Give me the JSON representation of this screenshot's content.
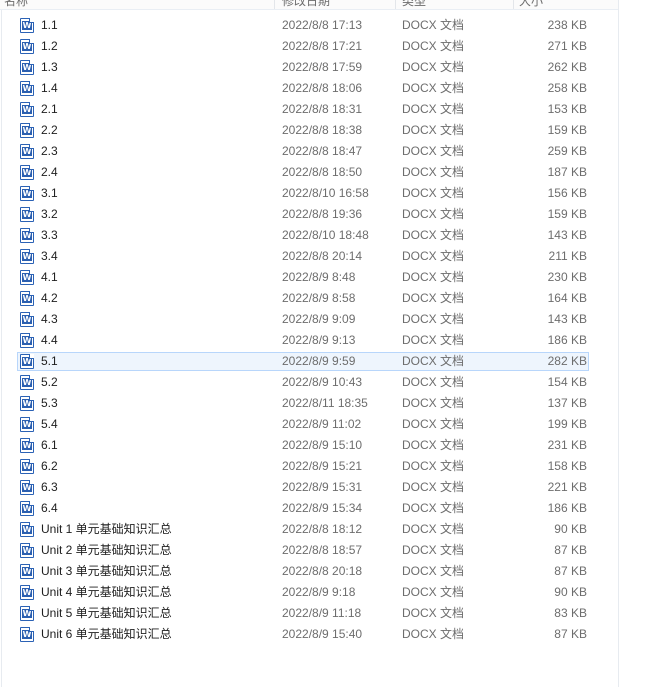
{
  "header": {
    "name": "名称",
    "date": "修改日期",
    "type": "类型",
    "size": "大小"
  },
  "icon_label": "W",
  "files": [
    {
      "name": "1.1",
      "date": "2022/8/8 17:13",
      "type": "DOCX 文档",
      "size": "238 KB"
    },
    {
      "name": "1.2",
      "date": "2022/8/8 17:21",
      "type": "DOCX 文档",
      "size": "271 KB"
    },
    {
      "name": "1.3",
      "date": "2022/8/8 17:59",
      "type": "DOCX 文档",
      "size": "262 KB"
    },
    {
      "name": "1.4",
      "date": "2022/8/8 18:06",
      "type": "DOCX 文档",
      "size": "258 KB"
    },
    {
      "name": "2.1",
      "date": "2022/8/8 18:31",
      "type": "DOCX 文档",
      "size": "153 KB"
    },
    {
      "name": "2.2",
      "date": "2022/8/8 18:38",
      "type": "DOCX 文档",
      "size": "159 KB"
    },
    {
      "name": "2.3",
      "date": "2022/8/8 18:47",
      "type": "DOCX 文档",
      "size": "259 KB"
    },
    {
      "name": "2.4",
      "date": "2022/8/8 18:50",
      "type": "DOCX 文档",
      "size": "187 KB"
    },
    {
      "name": "3.1",
      "date": "2022/8/10 16:58",
      "type": "DOCX 文档",
      "size": "156 KB"
    },
    {
      "name": "3.2",
      "date": "2022/8/8 19:36",
      "type": "DOCX 文档",
      "size": "159 KB"
    },
    {
      "name": "3.3",
      "date": "2022/8/10 18:48",
      "type": "DOCX 文档",
      "size": "143 KB"
    },
    {
      "name": "3.4",
      "date": "2022/8/8 20:14",
      "type": "DOCX 文档",
      "size": "211 KB"
    },
    {
      "name": "4.1",
      "date": "2022/8/9 8:48",
      "type": "DOCX 文档",
      "size": "230 KB"
    },
    {
      "name": "4.2",
      "date": "2022/8/9 8:58",
      "type": "DOCX 文档",
      "size": "164 KB"
    },
    {
      "name": "4.3",
      "date": "2022/8/9 9:09",
      "type": "DOCX 文档",
      "size": "143 KB"
    },
    {
      "name": "4.4",
      "date": "2022/8/9 9:13",
      "type": "DOCX 文档",
      "size": "186 KB"
    },
    {
      "name": "5.1",
      "date": "2022/8/9 9:59",
      "type": "DOCX 文档",
      "size": "282 KB",
      "selected": true
    },
    {
      "name": "5.2",
      "date": "2022/8/9 10:43",
      "type": "DOCX 文档",
      "size": "154 KB"
    },
    {
      "name": "5.3",
      "date": "2022/8/11 18:35",
      "type": "DOCX 文档",
      "size": "137 KB"
    },
    {
      "name": "5.4",
      "date": "2022/8/9 11:02",
      "type": "DOCX 文档",
      "size": "199 KB"
    },
    {
      "name": "6.1",
      "date": "2022/8/9 15:10",
      "type": "DOCX 文档",
      "size": "231 KB"
    },
    {
      "name": "6.2",
      "date": "2022/8/9 15:21",
      "type": "DOCX 文档",
      "size": "158 KB"
    },
    {
      "name": "6.3",
      "date": "2022/8/9 15:31",
      "type": "DOCX 文档",
      "size": "221 KB"
    },
    {
      "name": "6.4",
      "date": "2022/8/9 15:34",
      "type": "DOCX 文档",
      "size": "186 KB"
    },
    {
      "name": "Unit 1  单元基础知识汇总",
      "date": "2022/8/8 18:12",
      "type": "DOCX 文档",
      "size": "90 KB"
    },
    {
      "name": "Unit 2 单元基础知识汇总",
      "date": "2022/8/8 18:57",
      "type": "DOCX 文档",
      "size": "87 KB"
    },
    {
      "name": "Unit 3 单元基础知识汇总",
      "date": "2022/8/8 20:18",
      "type": "DOCX 文档",
      "size": "87 KB"
    },
    {
      "name": "Unit 4 单元基础知识汇总",
      "date": "2022/8/9 9:18",
      "type": "DOCX 文档",
      "size": "90 KB"
    },
    {
      "name": "Unit 5  单元基础知识汇总",
      "date": "2022/8/9 11:18",
      "type": "DOCX 文档",
      "size": "83 KB"
    },
    {
      "name": "Unit 6  单元基础知识汇总",
      "date": "2022/8/9 15:40",
      "type": "DOCX 文档",
      "size": "87 KB"
    }
  ]
}
